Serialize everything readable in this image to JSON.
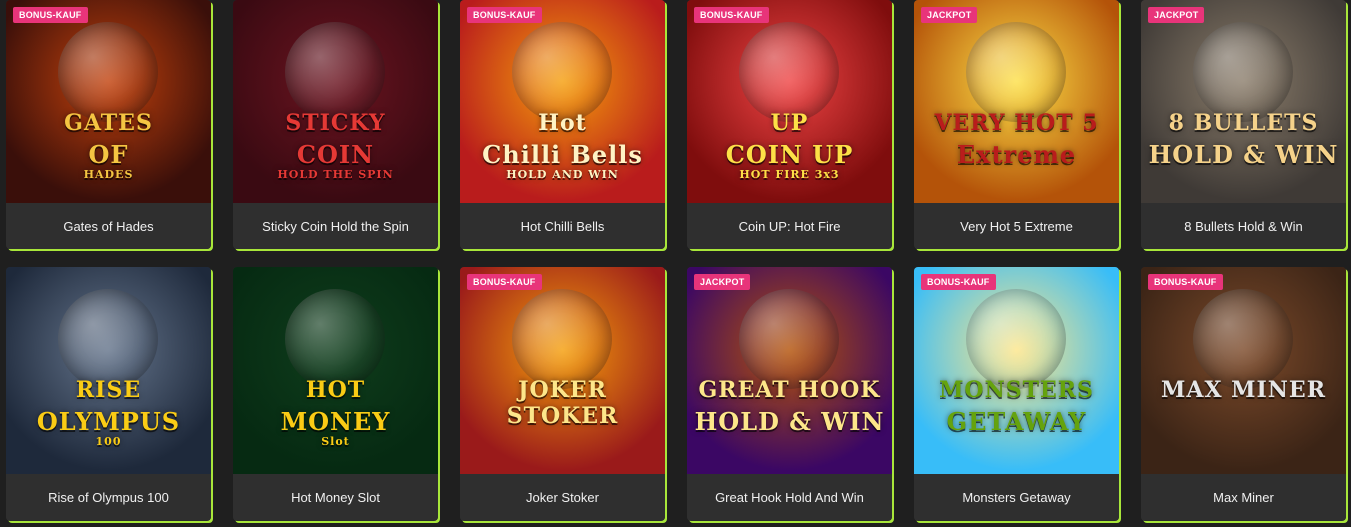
{
  "games": [
    {
      "title": "Gates of Hades",
      "badge": "BONUS-KAUF",
      "art": [
        "GATES",
        "OF",
        "HADES"
      ],
      "bg1": "#3a0f0a",
      "bg2": "#c2410c",
      "textColor": "#f4c542"
    },
    {
      "title": "Sticky Coin Hold the Spin",
      "badge": "",
      "art": [
        "STICKY",
        "COIN",
        "HOLD THE SPIN"
      ],
      "bg1": "#3a0a12",
      "bg2": "#6b1420",
      "textColor": "#e53935"
    },
    {
      "title": "Hot Chilli Bells",
      "badge": "BONUS-KAUF",
      "art": [
        "Hot",
        "Chilli Bells",
        "HOLD AND WIN"
      ],
      "bg1": "#b91c1c",
      "bg2": "#f59e0b",
      "textColor": "#fff3c4"
    },
    {
      "title": "Coin UP: Hot Fire",
      "badge": "BONUS-KAUF",
      "art": [
        "UP",
        "COIN UP",
        "HOT FIRE 3x3"
      ],
      "bg1": "#7f0d0d",
      "bg2": "#ef4444",
      "textColor": "#fde047"
    },
    {
      "title": "Very Hot 5 Extreme",
      "badge": "JACKPOT",
      "art": [
        "VERY HOT 5",
        "Extreme",
        ""
      ],
      "bg1": "#b45309",
      "bg2": "#fde047",
      "textColor": "#b91c1c"
    },
    {
      "title": "8 Bullets Hold & Win",
      "badge": "JACKPOT",
      "art": [
        "8 BULLETS",
        "HOLD & WIN",
        ""
      ],
      "bg1": "#3f3a36",
      "bg2": "#8b7d6b",
      "textColor": "#f5d28a"
    },
    {
      "title": "Rise of Olympus 100",
      "badge": "",
      "art": [
        "RISE",
        "OLYMPUS",
        "100"
      ],
      "bg1": "#1e293b",
      "bg2": "#64748b",
      "textColor": "#facc15"
    },
    {
      "title": "Hot Money Slot",
      "badge": "",
      "art": [
        "HOT",
        "MONEY",
        "Slot"
      ],
      "bg1": "#062a12",
      "bg2": "#0f3d1c",
      "textColor": "#facc15"
    },
    {
      "title": "Joker Stoker",
      "badge": "BONUS-KAUF",
      "art": [
        "JOKER STOKER",
        "",
        ""
      ],
      "bg1": "#9a1a1a",
      "bg2": "#f59e0b",
      "textColor": "#fde68a"
    },
    {
      "title": "Great Hook Hold And Win",
      "badge": "JACKPOT",
      "art": [
        "GREAT HOOK",
        "HOLD & WIN",
        ""
      ],
      "bg1": "#3b0764",
      "bg2": "#b45309",
      "textColor": "#fde68a"
    },
    {
      "title": "Monsters Getaway",
      "badge": "BONUS-KAUF",
      "art": [
        "MONSTERS",
        "GETAWAY",
        ""
      ],
      "bg1": "#38bdf8",
      "bg2": "#fde68a",
      "textColor": "#65a30d"
    },
    {
      "title": "Max Miner",
      "badge": "BONUS-KAUF",
      "art": [
        "MAX MINER",
        "",
        ""
      ],
      "bg1": "#3b2416",
      "bg2": "#7c4a2a",
      "textColor": "#e5e5e5"
    }
  ]
}
